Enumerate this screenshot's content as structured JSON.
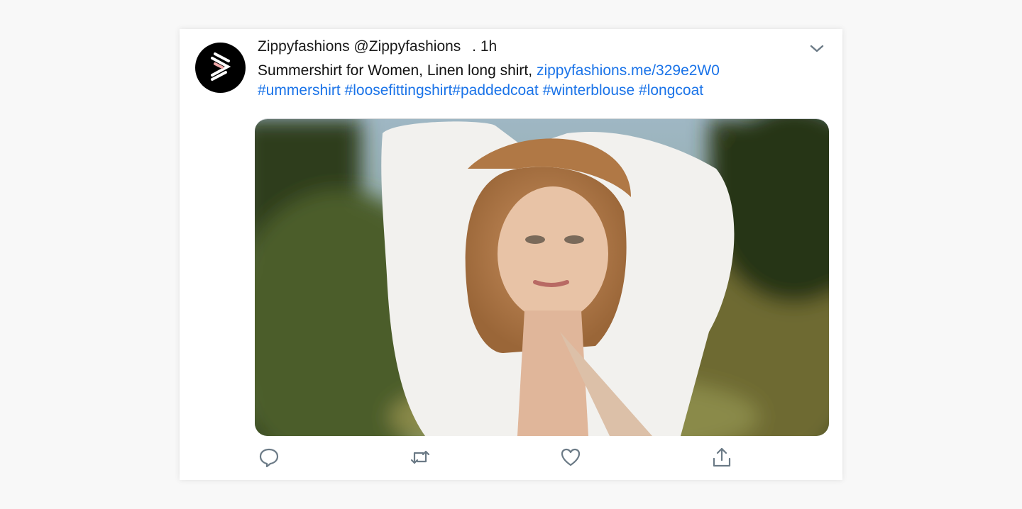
{
  "tweet": {
    "display_name": "Zippyfashions",
    "handle": "@Zippyfashions",
    "time": ". 1h",
    "text": "Summershirt for Women, Linen long shirt,",
    "link": "zippyfashions.me/329e2W0",
    "hashtags": [
      "#ummershirt",
      "#loosefittingshirt",
      "#paddedcoat",
      "#winterblouse",
      "#longcoat"
    ]
  },
  "icons": {
    "menu": "chevron-down-icon",
    "reply": "speech-bubble-icon",
    "retweet": "retweet-icon",
    "like": "heart-icon",
    "share": "share-upload-icon"
  },
  "colors": {
    "link": "#1a73e8",
    "icon": "#6b7a86",
    "avatar_bg": "#000000",
    "page_bg": "#f8f8f8"
  }
}
